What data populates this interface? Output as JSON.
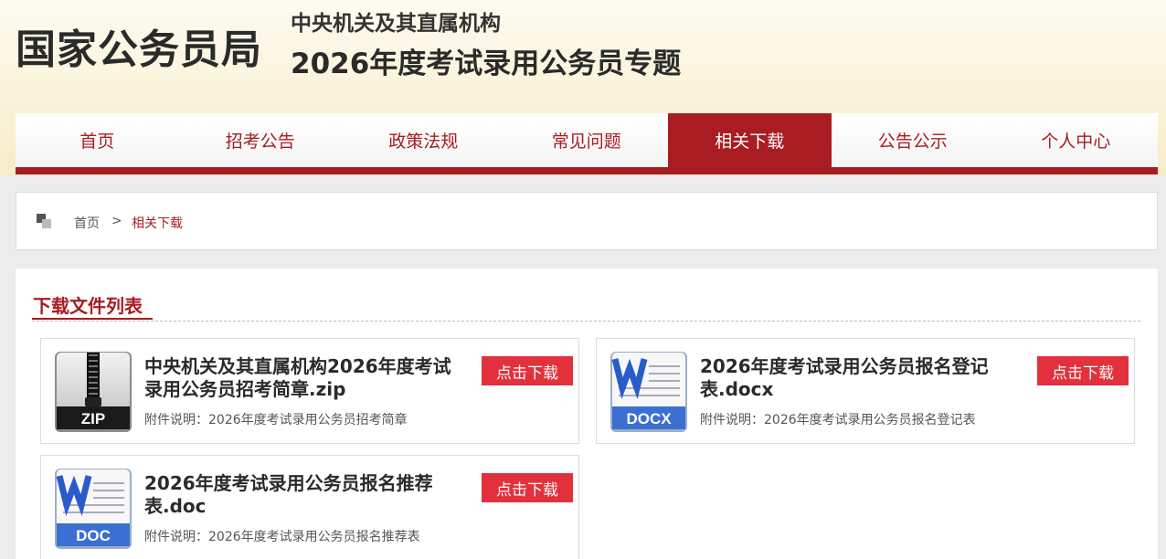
{
  "header": {
    "logo": "国家公务员局",
    "subtitle1": "中央机关及其直属机构",
    "subtitle2": "2026年度考试录用公务员专题"
  },
  "nav": [
    {
      "label": "首页"
    },
    {
      "label": "招考公告"
    },
    {
      "label": "政策法规"
    },
    {
      "label": "常见问题"
    },
    {
      "label": "相关下载",
      "active": true
    },
    {
      "label": "公告公示"
    },
    {
      "label": "个人中心"
    }
  ],
  "breadcrumb": {
    "home": "首页",
    "sep": ">",
    "current": "相关下载"
  },
  "panel": {
    "title": "下载文件列表"
  },
  "files": [
    {
      "icon": "zip-file-icon",
      "icon_label": "ZIP",
      "name": "中央机关及其直属机构2026年度考试录用公务员招考简章.zip",
      "desc": "附件说明：2026年度考试录用公务员招考简章",
      "button": "点击下载"
    },
    {
      "icon": "word-file-icon",
      "icon_label": "DOCX",
      "name": "2026年度考试录用公务员报名登记表.docx",
      "desc": "附件说明：2026年度考试录用公务员报名登记表",
      "button": "点击下载"
    },
    {
      "icon": "word-file-icon",
      "icon_label": "DOC",
      "name": "2026年度考试录用公务员报名推荐表.doc",
      "desc": "附件说明：2026年度考试录用公务员报名推荐表",
      "button": "点击下载"
    }
  ],
  "colors": {
    "brand_red": "#a81c22",
    "button_red": "#e2313c",
    "header_bg": "#fbf3d9"
  }
}
